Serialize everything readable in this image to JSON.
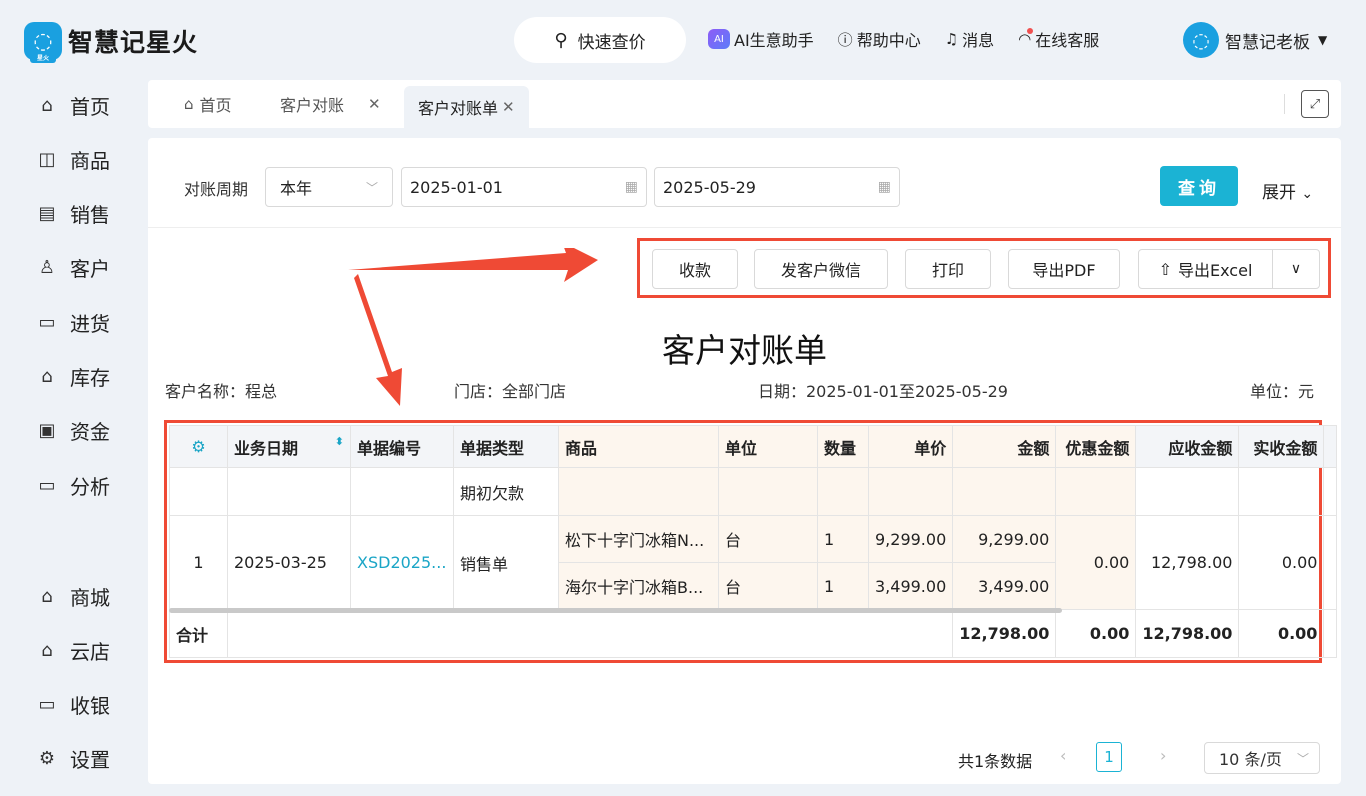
{
  "app": {
    "logo_glyph": "◌",
    "logo_tag": "星火",
    "name": "智慧记星火"
  },
  "header": {
    "quick_search": "快速查价",
    "links": [
      {
        "label": "AI生意助手",
        "icon": "ai-assistant-icon"
      },
      {
        "label": "帮助中心",
        "icon": "help-icon"
      },
      {
        "label": "消息",
        "icon": "bell-icon"
      },
      {
        "label": "在线客服",
        "icon": "headset-icon"
      }
    ],
    "user_name": "智慧记老板"
  },
  "sidebar": {
    "items": [
      {
        "label": "首页",
        "icon": "home-icon"
      },
      {
        "label": "商品",
        "icon": "bag-icon"
      },
      {
        "label": "销售",
        "icon": "clipboard-icon"
      },
      {
        "label": "客户",
        "icon": "user-icon"
      },
      {
        "label": "进货",
        "icon": "inbound-icon"
      },
      {
        "label": "库存",
        "icon": "warehouse-icon"
      },
      {
        "label": "资金",
        "icon": "wallet-icon"
      },
      {
        "label": "分析",
        "icon": "chart-icon"
      },
      {
        "label": "商城",
        "icon": "mall-icon"
      },
      {
        "label": "云店",
        "icon": "store-icon"
      },
      {
        "label": "收银",
        "icon": "cashier-icon"
      },
      {
        "label": "设置",
        "icon": "gear-icon"
      }
    ]
  },
  "tabs": [
    {
      "label": "首页"
    },
    {
      "label": "客户对账"
    },
    {
      "label": "客户对账单"
    }
  ],
  "filter": {
    "period_label": "对账周期",
    "period_value": "本年",
    "start_date": "2025-01-01",
    "end_date": "2025-05-29",
    "query_label": "查询",
    "expand_label": "展开"
  },
  "toolbar": {
    "collect": "收款",
    "wechat": "发客户微信",
    "print": "打印",
    "pdf": "导出PDF",
    "excel": "导出Excel"
  },
  "statement": {
    "title": "客户对账单",
    "customer": "客户名称：程总",
    "store": "门店：全部门店",
    "date": "日期：2025-01-01至2025-05-29",
    "unit": "单位：元"
  },
  "table": {
    "headers": [
      "业务日期",
      "单据编号",
      "单据类型",
      "商品",
      "单位",
      "数量",
      "单价",
      "金额",
      "优惠金额",
      "应收金额",
      "实收金额"
    ],
    "opening_row": {
      "type": "期初欠款"
    },
    "order": {
      "index": "1",
      "date": "2025-03-25",
      "number": "XSD2025...",
      "type": "销售单",
      "discount": "0.00",
      "receivable": "12,798.00",
      "received": "0.00",
      "items": [
        {
          "product": "松下十字门冰箱N...",
          "unit": "台",
          "qty": "1",
          "price": "9,299.00",
          "amount": "9,299.00"
        },
        {
          "product": "海尔十字门冰箱B...",
          "unit": "台",
          "qty": "1",
          "price": "3,499.00",
          "amount": "3,499.00"
        }
      ]
    },
    "total": {
      "label": "合计",
      "amount": "12,798.00",
      "discount": "0.00",
      "receivable": "12,798.00",
      "received": "0.00"
    }
  },
  "pagination": {
    "summary": "共1条数据",
    "current_page": "1",
    "page_size": "10 条/页"
  },
  "colors": {
    "accent": "#1bb3d4",
    "highlight": "#ef4a35"
  }
}
